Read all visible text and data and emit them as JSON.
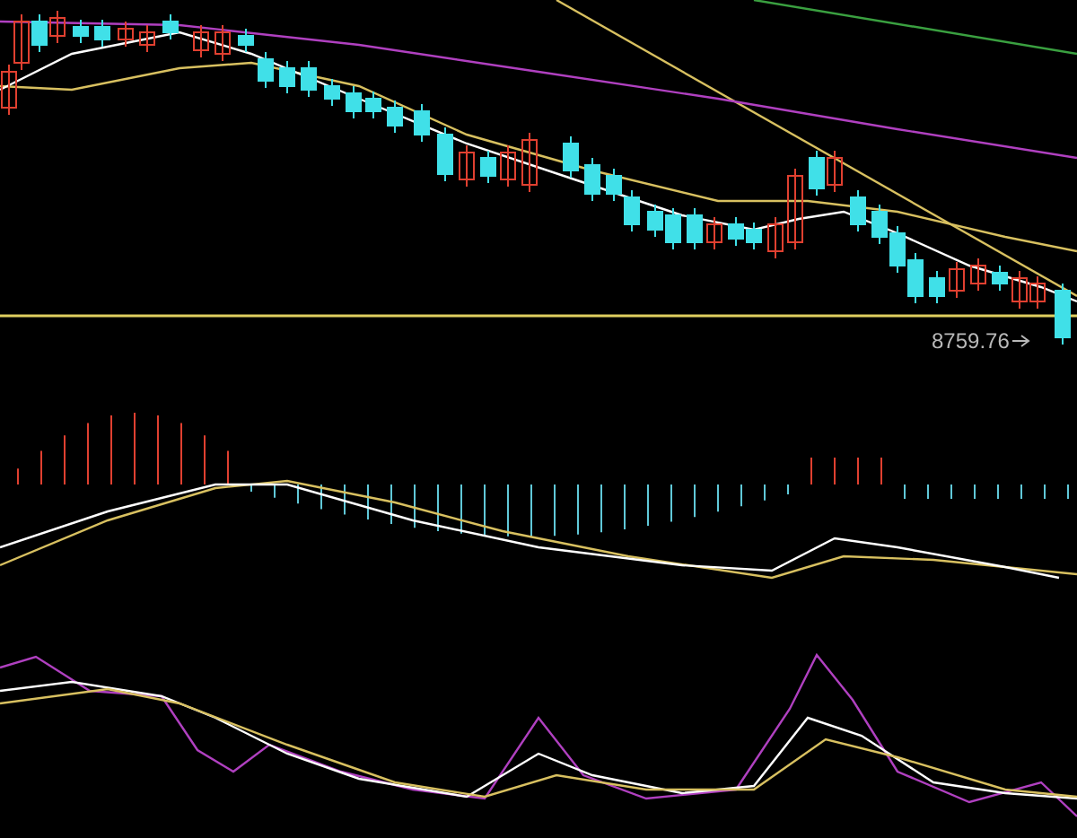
{
  "price_label": {
    "text": "8759.76"
  }
}
